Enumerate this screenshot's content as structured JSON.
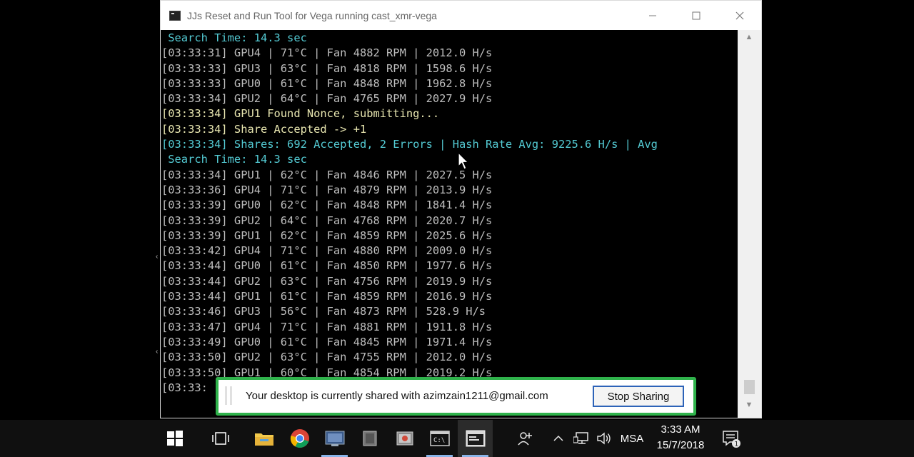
{
  "window": {
    "title": "JJs Reset and Run Tool for Vega running cast_xmr-vega",
    "minimize_icon": "minimize-icon",
    "maximize_icon": "maximize-icon",
    "close_icon": "close-icon"
  },
  "console": {
    "lines": [
      {
        "text": " Search Time: 14.3 sec",
        "color": "cyan"
      },
      {
        "text": "[03:33:31] GPU4 | 71°C | Fan 4882 RPM | 2012.0 H/s",
        "color": "gray"
      },
      {
        "text": "[03:33:33] GPU3 | 63°C | Fan 4818 RPM | 1598.6 H/s",
        "color": "gray"
      },
      {
        "text": "[03:33:33] GPU0 | 61°C | Fan 4848 RPM | 1962.8 H/s",
        "color": "gray"
      },
      {
        "text": "[03:33:34] GPU2 | 64°C | Fan 4765 RPM | 2027.9 H/s",
        "color": "gray"
      },
      {
        "text": "[03:33:34] GPU1 Found Nonce, submitting...",
        "color": "yellow"
      },
      {
        "text": "[03:33:34] Share Accepted -> +1",
        "color": "yellow"
      },
      {
        "text": "[03:33:34] Shares: 692 Accepted, 2 Errors | Hash Rate Avg: 9225.6 H/s | Avg",
        "color": "cyan"
      },
      {
        "text": " Search Time: 14.3 sec",
        "color": "cyan"
      },
      {
        "text": "[03:33:34] GPU1 | 62°C | Fan 4846 RPM | 2027.5 H/s",
        "color": "gray"
      },
      {
        "text": "[03:33:36] GPU4 | 71°C | Fan 4879 RPM | 2013.9 H/s",
        "color": "gray"
      },
      {
        "text": "[03:33:39] GPU0 | 62°C | Fan 4848 RPM | 1841.4 H/s",
        "color": "gray"
      },
      {
        "text": "[03:33:39] GPU2 | 64°C | Fan 4768 RPM | 2020.7 H/s",
        "color": "gray"
      },
      {
        "text": "[03:33:39] GPU1 | 62°C | Fan 4859 RPM | 2025.6 H/s",
        "color": "gray"
      },
      {
        "text": "[03:33:42] GPU4 | 71°C | Fan 4880 RPM | 2009.0 H/s",
        "color": "gray"
      },
      {
        "text": "[03:33:44] GPU0 | 61°C | Fan 4850 RPM | 1977.6 H/s",
        "color": "gray"
      },
      {
        "text": "[03:33:44] GPU2 | 63°C | Fan 4756 RPM | 2019.9 H/s",
        "color": "gray"
      },
      {
        "text": "[03:33:44] GPU1 | 61°C | Fan 4859 RPM | 2016.9 H/s",
        "color": "gray"
      },
      {
        "text": "[03:33:46] GPU3 | 56°C | Fan 4873 RPM | 528.9 H/s",
        "color": "gray"
      },
      {
        "text": "[03:33:47] GPU4 | 71°C | Fan 4881 RPM | 1911.8 H/s",
        "color": "gray"
      },
      {
        "text": "[03:33:49] GPU0 | 61°C | Fan 4845 RPM | 1971.4 H/s",
        "color": "gray"
      },
      {
        "text": "[03:33:50] GPU2 | 63°C | Fan 4755 RPM | 2012.0 H/s",
        "color": "gray"
      },
      {
        "text": "[03:33:50] GPU1 | 60°C | Fan 4854 RPM | 2019.2 H/s",
        "color": "gray"
      },
      {
        "text": "[03:33:",
        "color": "gray"
      }
    ]
  },
  "share_bar": {
    "message": "Your desktop is currently shared with azimzain1211@gmail.com",
    "stop_label": "Stop Sharing"
  },
  "taskbar": {
    "items": [
      "start-icon",
      "task-view-icon",
      "file-explorer-icon",
      "chrome-icon",
      "app-icon",
      "app-icon-2",
      "app-icon-3",
      "command-prompt-icon",
      "console-app-icon"
    ],
    "language": "MSA",
    "time": "3:33 AM",
    "date": "15/7/2018"
  },
  "colors": {
    "cyan": "#54cbd4",
    "yellow": "#e8e6b0",
    "gray": "#bdbdbd",
    "share_border": "#2fb24b",
    "stop_border": "#2d63b8"
  }
}
